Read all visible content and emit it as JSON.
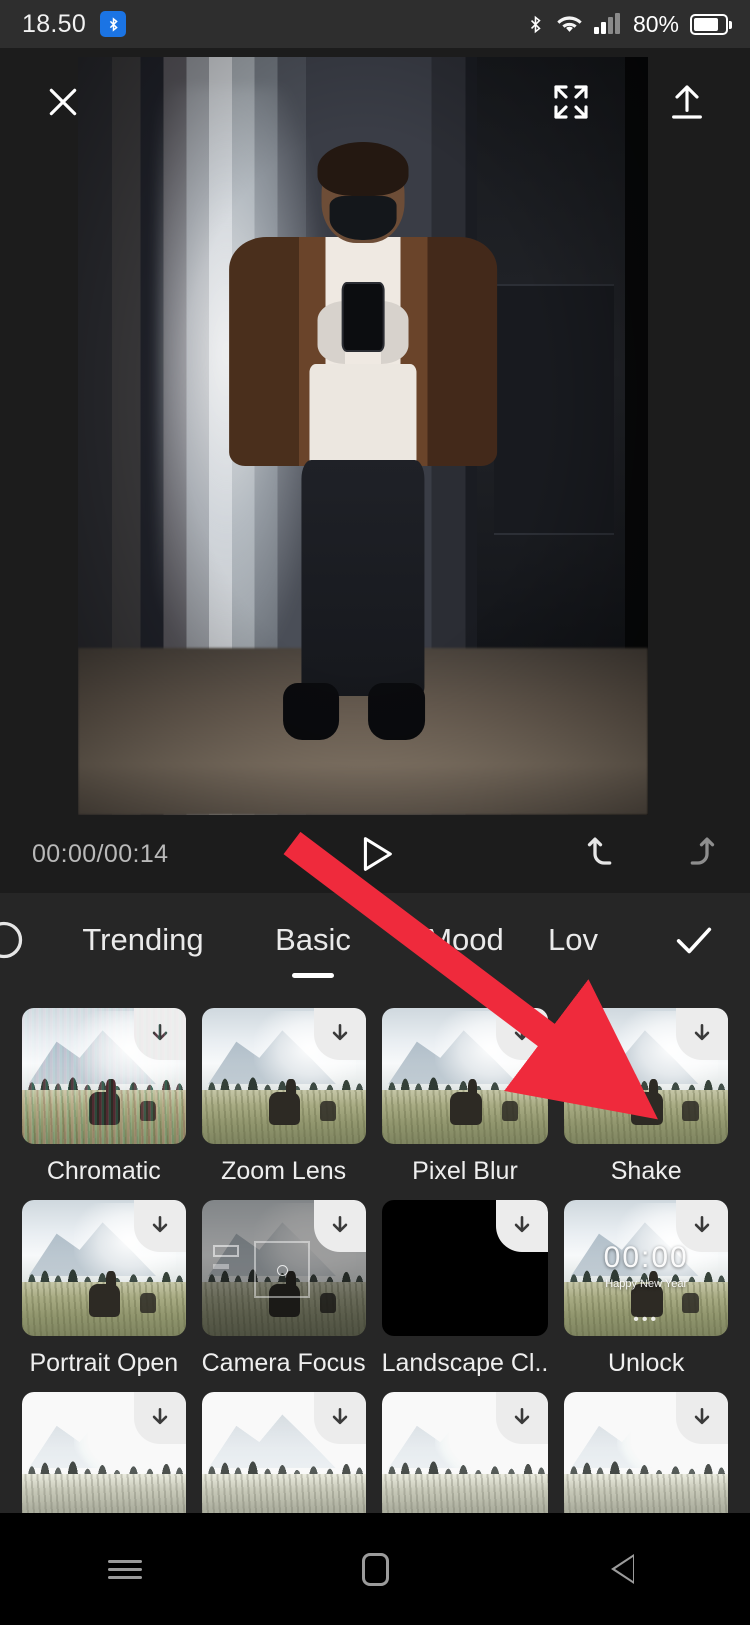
{
  "status_bar": {
    "time": "18.50",
    "bluetooth_badge_icon": "bluetooth-badge-icon",
    "bluetooth_icon": "bluetooth-icon",
    "wifi_icon": "wifi-icon",
    "signal_icon": "cellular-signal-icon",
    "battery_percent": "80%",
    "battery_icon": "battery-icon"
  },
  "top_bar": {
    "close_icon": "close-icon",
    "fullscreen_icon": "fullscreen-expand-icon",
    "export_icon": "export-upload-icon"
  },
  "player": {
    "time_current": "00:00",
    "time_total": "00:14",
    "time_display": "00:00/00:14",
    "play_icon": "play-icon",
    "undo_icon": "undo-icon",
    "redo_icon": "redo-icon"
  },
  "effects_panel": {
    "left_scroll_icon": "recent-history-icon",
    "confirm_icon": "check-icon",
    "tabs": [
      {
        "label": "Trending",
        "active": false
      },
      {
        "label": "Basic",
        "active": true
      },
      {
        "label": "Mood",
        "active": false
      },
      {
        "label": "Lov",
        "active": false
      }
    ],
    "rows": [
      {
        "items": [
          {
            "label": "Chromatic",
            "download_icon": "download-icon"
          },
          {
            "label": "Zoom Lens",
            "download_icon": "download-icon"
          },
          {
            "label": "Pixel Blur",
            "download_icon": "download-icon"
          },
          {
            "label": "Shake",
            "download_icon": "download-icon"
          }
        ]
      },
      {
        "items": [
          {
            "label": "Portrait Open",
            "download_icon": "download-icon"
          },
          {
            "label": "Camera Focus",
            "download_icon": "download-icon"
          },
          {
            "label": "Landscape Cl..",
            "download_icon": "download-icon"
          },
          {
            "label": "Unlock",
            "download_icon": "download-icon",
            "overlay_clock": "00:00",
            "overlay_text": "Happy New Year",
            "overlay_dots": "•••"
          }
        ]
      },
      {
        "items": [
          {
            "label": "",
            "download_icon": "download-icon"
          },
          {
            "label": "",
            "download_icon": "download-icon"
          },
          {
            "label": "",
            "download_icon": "download-icon"
          },
          {
            "label": "",
            "download_icon": "download-icon"
          }
        ]
      }
    ]
  },
  "nav_bar": {
    "recents_icon": "recents-menu-icon",
    "home_icon": "home-square-icon",
    "back_icon": "back-triangle-icon"
  },
  "annotation": {
    "arrow_color": "#ef2a3c",
    "arrow_target": "Shake effect thumbnail"
  },
  "colors": {
    "panel_bg": "#262626",
    "app_bg": "#1c1c1c",
    "status_bg": "#2e2e2e",
    "accent_blue": "#1b74e4",
    "nav_bg": "#000000",
    "text_primary": "#eeeeee",
    "text_muted": "#b9b9b9"
  }
}
